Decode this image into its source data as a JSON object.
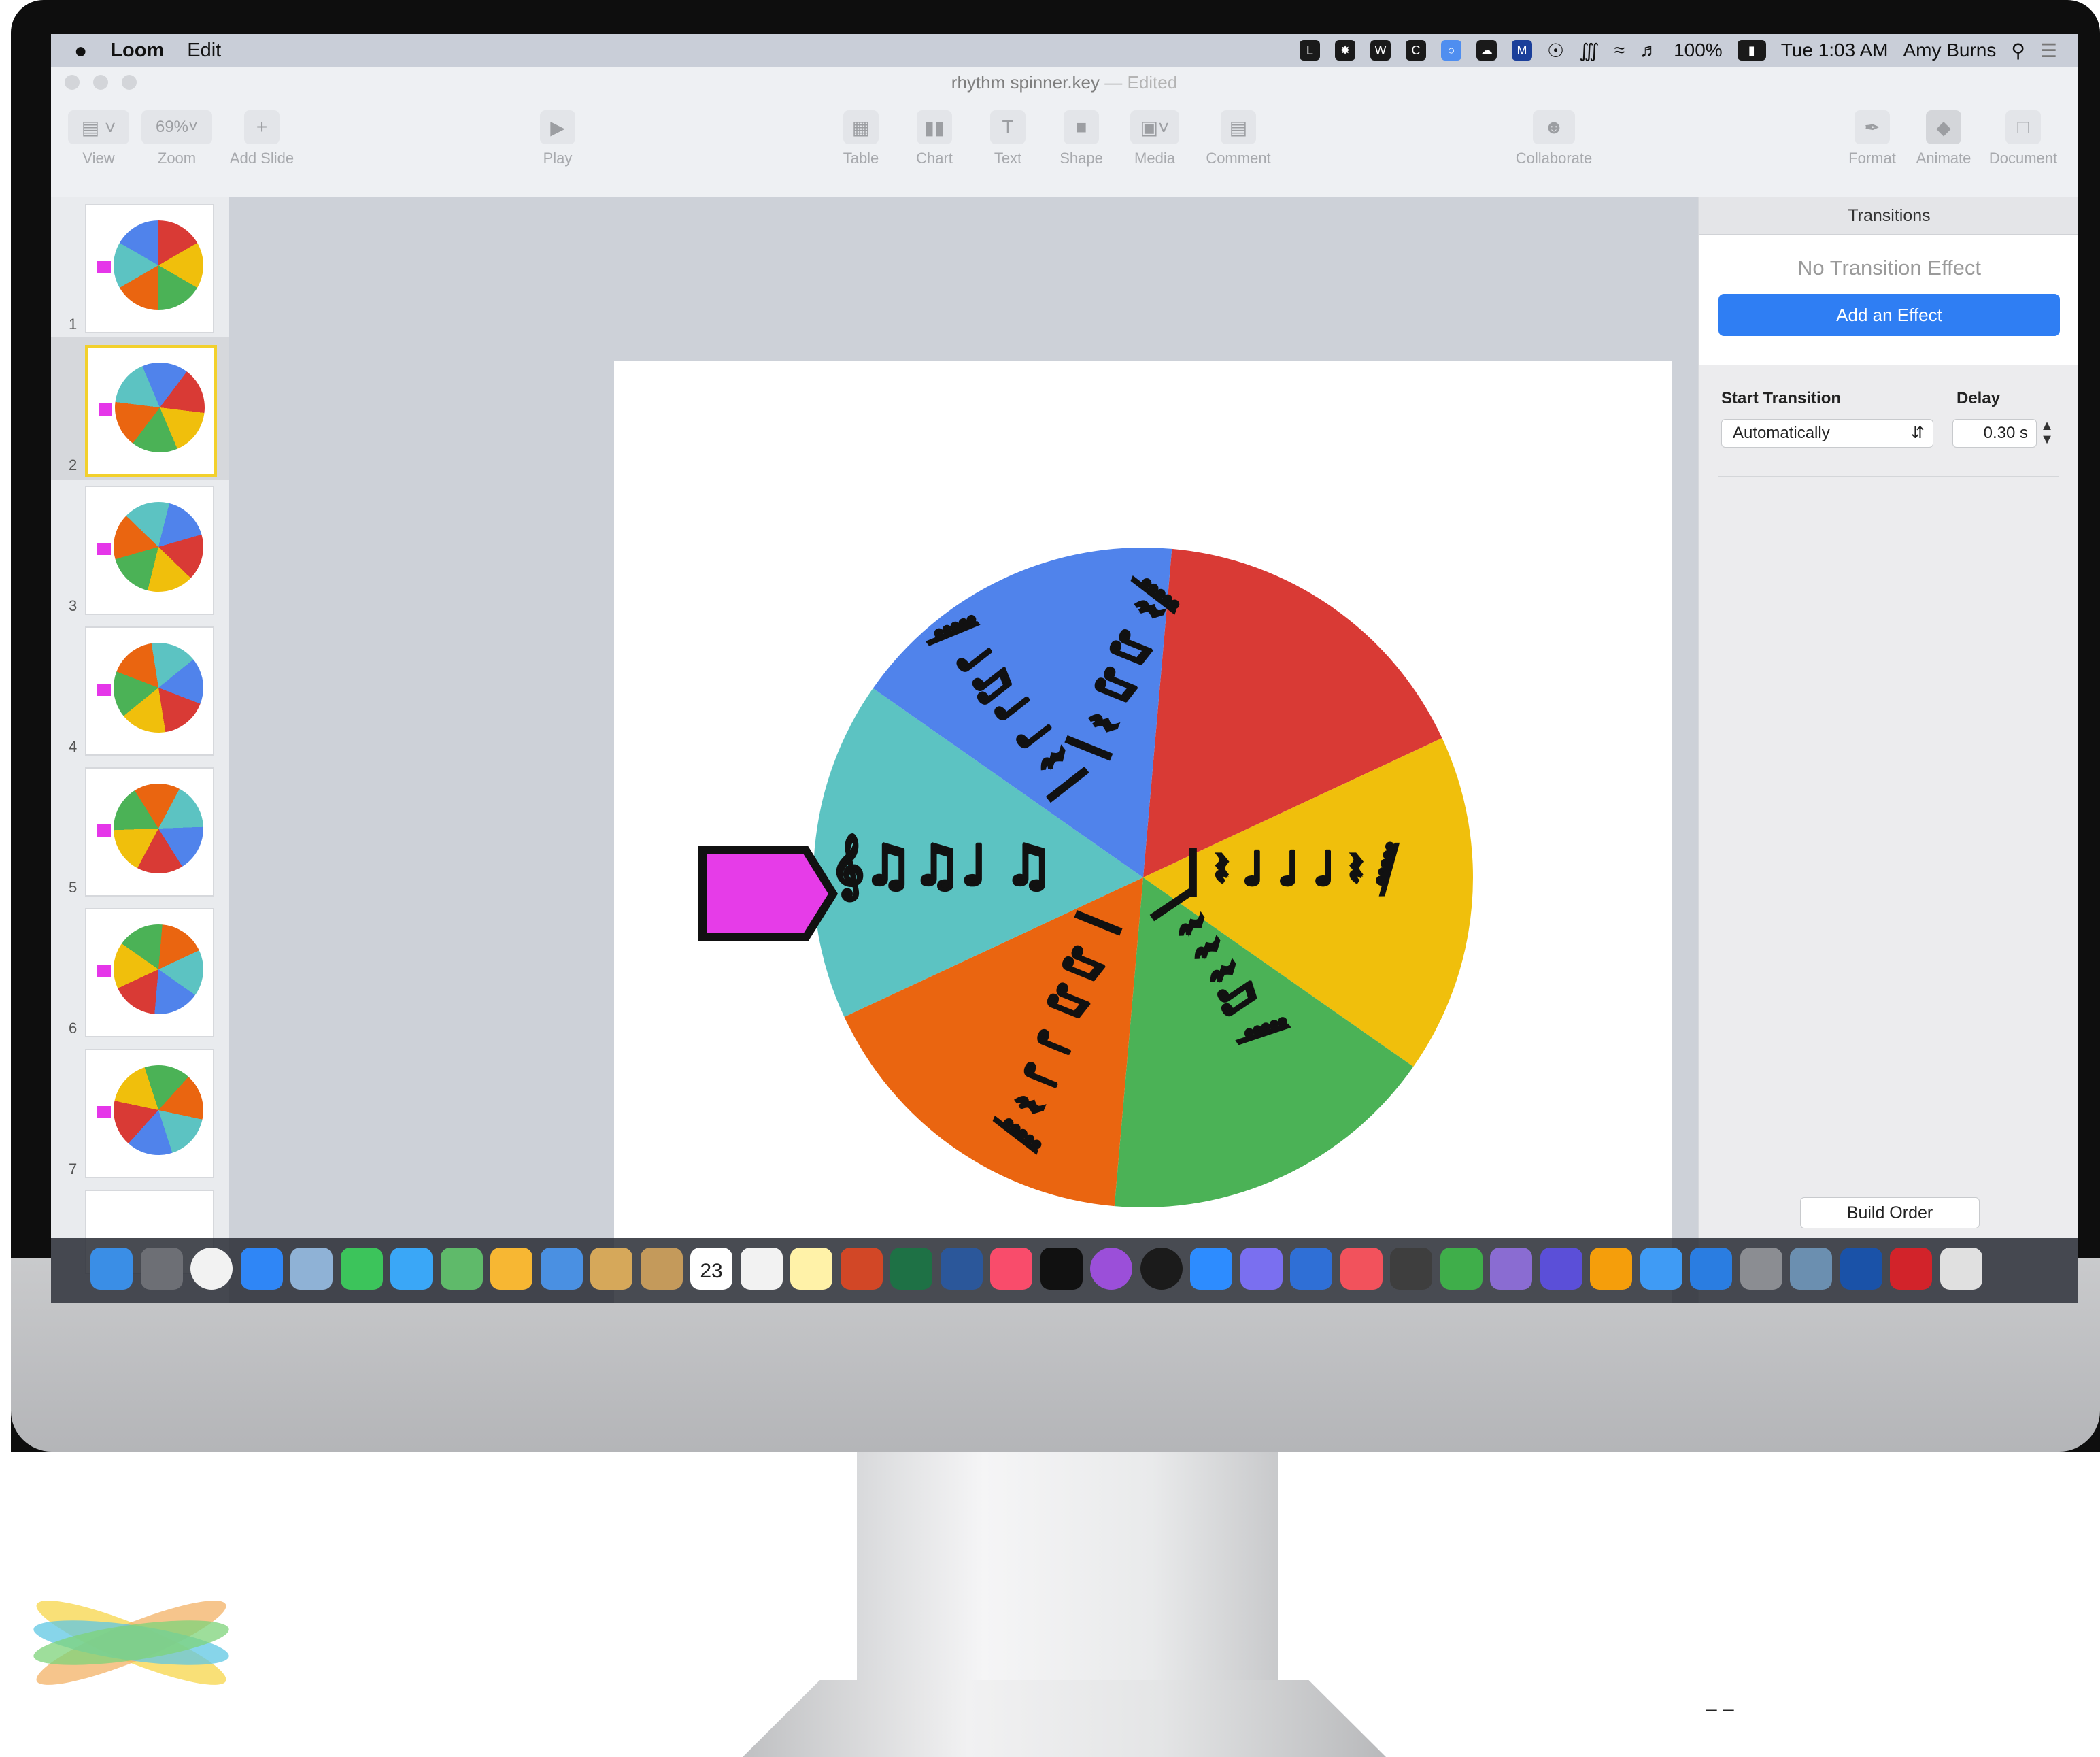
{
  "menubar": {
    "app_name": "Loom",
    "menu_edit": "Edit",
    "battery": "100%",
    "clock": "Tue 1:03 AM",
    "user": "Amy Burns",
    "status_icons": [
      "loom-icon",
      "gear-icon",
      "wd-icon",
      "creative-cloud-icon",
      "chrome-icon",
      "cloud-icon",
      "malwarebytes-icon",
      "accessibility-icon",
      "bluetooth-icon",
      "wifi-icon",
      "volume-icon",
      "battery-icon",
      "search-icon",
      "list-icon"
    ]
  },
  "window": {
    "title": "rhythm spinner.key",
    "title_suffix": "— Edited"
  },
  "toolbar": {
    "view_label": "View",
    "zoom_value": "69%",
    "zoom_label": "Zoom",
    "add_slide_label": "Add Slide",
    "play_label": "Play",
    "table_label": "Table",
    "chart_label": "Chart",
    "text_label": "Text",
    "shape_label": "Shape",
    "media_label": "Media",
    "comment_label": "Comment",
    "collaborate_label": "Collaborate",
    "format_label": "Format",
    "animate_label": "Animate",
    "document_label": "Document"
  },
  "navigator": {
    "slides": [
      {
        "num": "1",
        "selected": false
      },
      {
        "num": "2",
        "selected": true
      },
      {
        "num": "3",
        "selected": false
      },
      {
        "num": "4",
        "selected": false
      },
      {
        "num": "5",
        "selected": false
      },
      {
        "num": "6",
        "selected": false
      },
      {
        "num": "7",
        "selected": false
      }
    ]
  },
  "spinner": {
    "segment_colors": [
      "#d93a35",
      "#f0bf0c",
      "#4bb256",
      "#ea6510",
      "#5cc3c2",
      "#5083eb"
    ],
    "pointer_color": "#e63ce8"
  },
  "inspector": {
    "tab_title": "Transitions",
    "no_effect": "No Transition Effect",
    "add_effect": "Add an Effect",
    "start_transition_label": "Start Transition",
    "start_transition_value": "Automatically",
    "delay_label": "Delay",
    "delay_value": "0.30 s",
    "build_order": "Build Order"
  },
  "dock": {
    "calendar_day": "23",
    "apps": [
      "finder-icon",
      "launchpad-icon",
      "chrome-icon",
      "safari-icon",
      "preview-icon",
      "facetime-icon",
      "messages-icon",
      "maps-icon",
      "photos-icon",
      "keynote-icon",
      "notes-icon",
      "contacts-icon",
      "calendar-icon",
      "reminders-icon",
      "stickies-icon",
      "powerpoint-icon",
      "excel-icon",
      "word-icon",
      "music-icon",
      "star-wars-icon",
      "podcasts-icon",
      "tv-icon",
      "zoom-icon",
      "app-icon",
      "quicktime-icon",
      "news-icon",
      "clapper-icon",
      "numbers-icon",
      "game-icon",
      "imovie-icon",
      "pages-icon",
      "pencil-icon",
      "app-store-icon",
      "system-preferences-icon",
      "migration-icon",
      "wd-icon",
      "acrobat-icon",
      "trash-icon"
    ]
  }
}
